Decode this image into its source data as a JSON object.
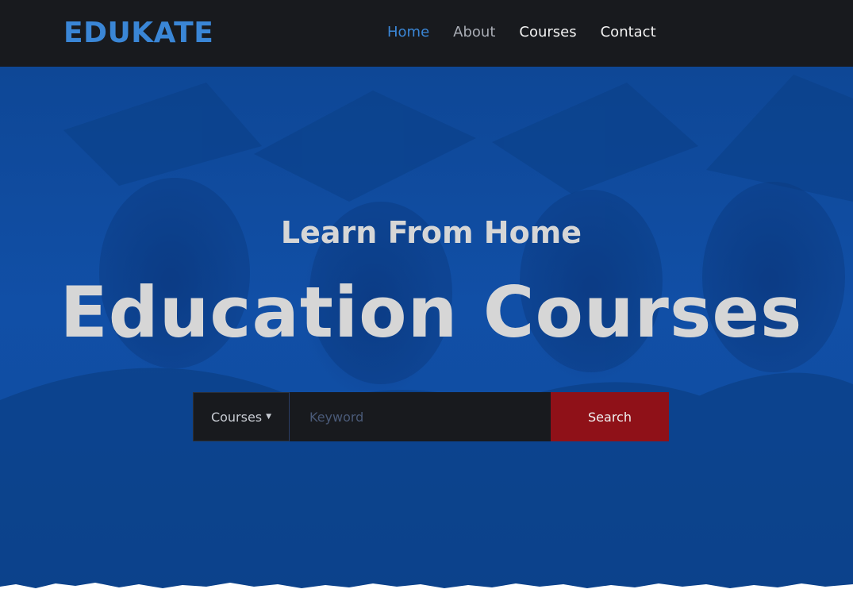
{
  "brand": {
    "name": "EDUKATE",
    "color": "#3a86d6"
  },
  "nav": {
    "items": [
      {
        "label": "Home",
        "color": "#3a86d6"
      },
      {
        "label": "About",
        "color": "#a9adb5"
      },
      {
        "label": "Courses",
        "color": "#f2f2f2"
      },
      {
        "label": "Contact",
        "color": "#f2f2f2"
      }
    ]
  },
  "hero": {
    "subtitle": "Learn From Home",
    "headline": "Education Courses",
    "text_color": "#d6d6d6"
  },
  "search": {
    "category_label": "Courses",
    "caret_icon": "caret-down-icon",
    "keyword_placeholder": "Keyword",
    "keyword_value": "",
    "button_label": "Search",
    "button_color": "#8f1118",
    "text_color": "#c9cdd4"
  },
  "colors": {
    "navbar": "#181a1e",
    "hero_overlay": "#0f4da1"
  }
}
